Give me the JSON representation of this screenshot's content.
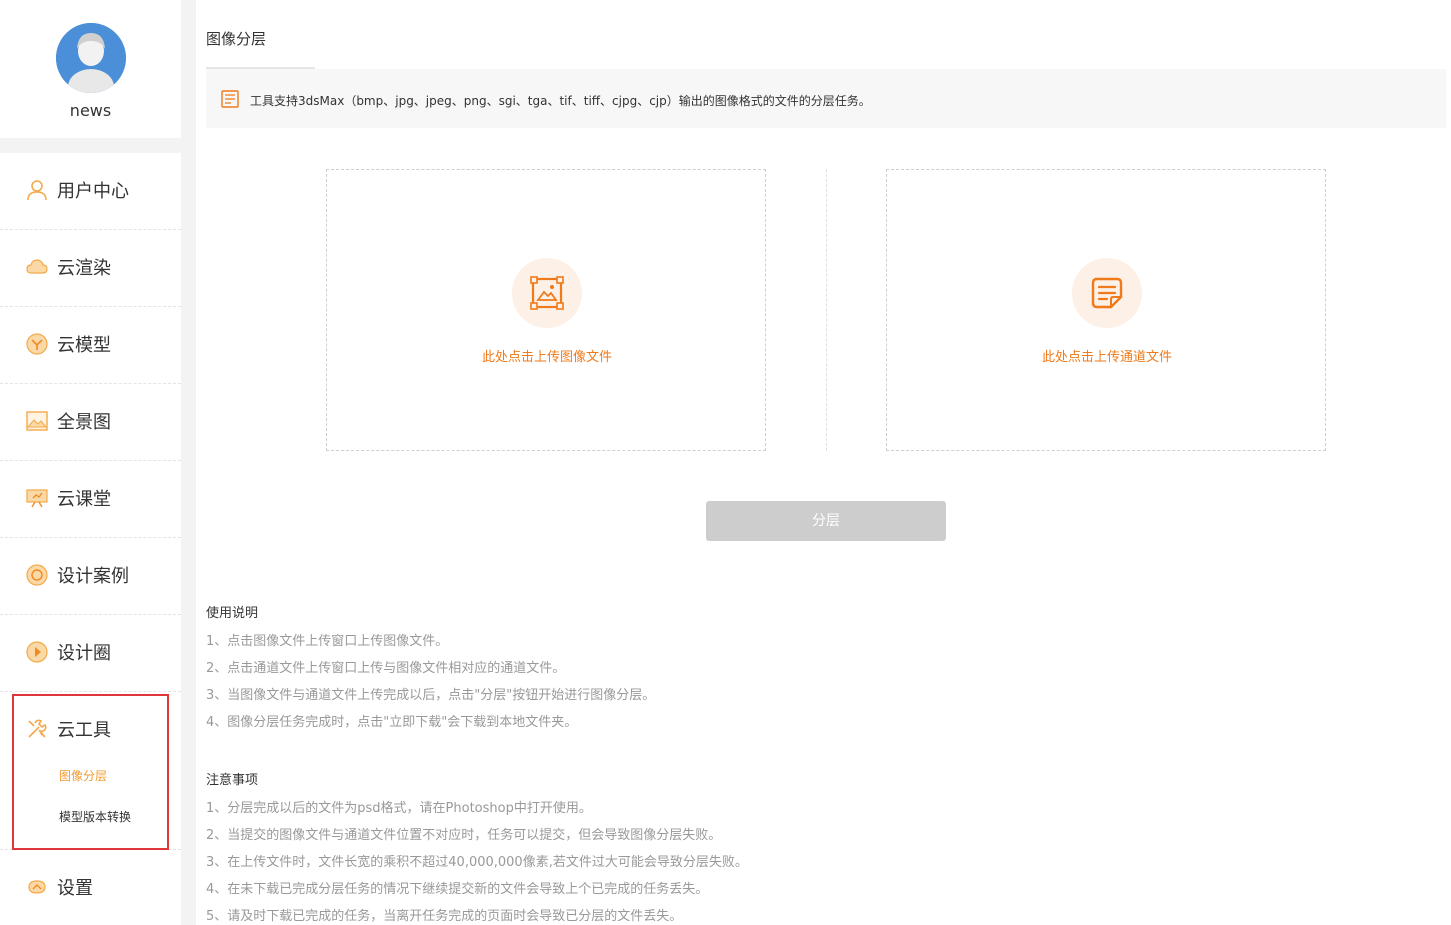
{
  "profile": {
    "username": "news"
  },
  "menu": {
    "items": [
      {
        "label": "用户中心",
        "icon": "user-icon"
      },
      {
        "label": "云渲染",
        "icon": "cloud-icon"
      },
      {
        "label": "云模型",
        "icon": "model-icon"
      },
      {
        "label": "全景图",
        "icon": "panorama-icon"
      },
      {
        "label": "云课堂",
        "icon": "classroom-icon"
      },
      {
        "label": "设计案例",
        "icon": "case-icon"
      },
      {
        "label": "设计圈",
        "icon": "circle-icon"
      }
    ],
    "tools": {
      "label": "云工具",
      "icon": "tools-icon",
      "sub": [
        {
          "label": "图像分层",
          "active": true
        },
        {
          "label": "模型版本转换",
          "active": false
        }
      ]
    },
    "settings": {
      "label": "设置",
      "icon": "settings-icon"
    }
  },
  "main": {
    "title": "图像分层",
    "notice": "工具支持3dsMax（bmp、jpg、jpeg、png、sgi、tga、tif、tiff、cjpg、cjp）输出的图像格式的文件的分层任务。",
    "upload_image": "此处点击上传图像文件",
    "upload_channel": "此处点击上传通道文件",
    "split_button": "分层",
    "usage": {
      "title": "使用说明",
      "lines": [
        "1、点击图像文件上传窗口上传图像文件。",
        "2、点击通道文件上传窗口上传与图像文件相对应的通道文件。",
        "3、当图像文件与通道文件上传完成以后，点击\"分层\"按钮开始进行图像分层。",
        "4、图像分层任务完成时，点击\"立即下载\"会下载到本地文件夹。"
      ]
    },
    "notes": {
      "title": "注意事项",
      "lines": [
        "1、分层完成以后的文件为psd格式，请在Photoshop中打开使用。",
        "2、当提交的图像文件与通道文件位置不对应时，任务可以提交，但会导致图像分层失败。",
        "3、在上传文件时，文件长宽的乘积不超过40,000,000像素,若文件过大可能会导致分层失败。",
        "4、在未下载已完成分层任务的情况下继续提交新的文件会导致上个已完成的任务丢失。",
        "5、请及时下载已完成的任务，当离开任务完成的页面时会导致已分层的文件丢失。"
      ]
    }
  },
  "colors": {
    "accent": "#f07a1a",
    "active_sub": "#f29a2e",
    "highlight_box": "#e0353b"
  }
}
